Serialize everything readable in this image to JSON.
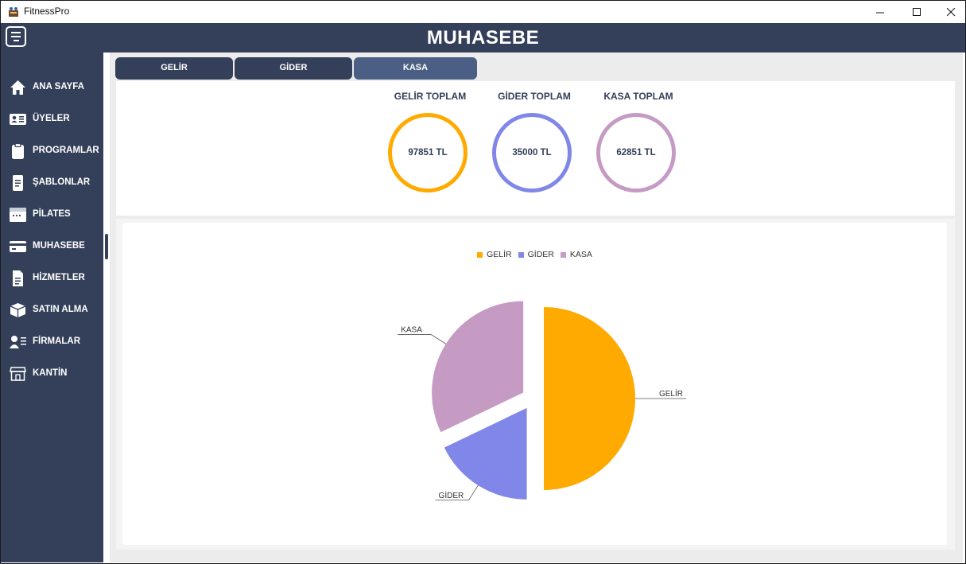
{
  "window": {
    "title": "FitnessPro",
    "controls": {
      "minimize": "—",
      "maximize": "☐",
      "close": "✕"
    }
  },
  "header": {
    "title": "MUHASEBE"
  },
  "sidebar": {
    "items": [
      {
        "label": "ANA SAYFA",
        "icon": "home-icon"
      },
      {
        "label": "ÜYELER",
        "icon": "member-card-icon"
      },
      {
        "label": "PROGRAMLAR",
        "icon": "clipboard-icon"
      },
      {
        "label": "ŞABLONLAR",
        "icon": "document-icon"
      },
      {
        "label": "PİLATES",
        "icon": "calendar-icon"
      },
      {
        "label": "MUHASEBE",
        "icon": "credit-card-icon",
        "active": true
      },
      {
        "label": "HİZMETLER",
        "icon": "file-icon"
      },
      {
        "label": "SATIN ALMA",
        "icon": "gift-box-icon"
      },
      {
        "label": "FİRMALAR",
        "icon": "person-list-icon"
      },
      {
        "label": "KANTİN",
        "icon": "store-icon"
      }
    ]
  },
  "tabs": [
    {
      "label": "GELİR",
      "active": false
    },
    {
      "label": "GİDER",
      "active": false
    },
    {
      "label": "KASA",
      "active": true
    }
  ],
  "totals": [
    {
      "title": "GELİR TOPLAM",
      "value": "97851 TL",
      "color": "#ffaa00"
    },
    {
      "title": "GİDER TOPLAM",
      "value": "35000 TL",
      "color": "#8087e8"
    },
    {
      "title": "KASA TOPLAM",
      "value": "62851 TL",
      "color": "#c59bc3"
    }
  ],
  "colors": {
    "navy": "#34405a",
    "tab_active": "#4b5f85",
    "background": "#ececec"
  },
  "chart_data": {
    "type": "pie",
    "title": "",
    "legend_position": "top-center",
    "categories": [
      "GELİR",
      "GİDER",
      "KASA"
    ],
    "values": [
      97851,
      35000,
      62851
    ],
    "colors": [
      "#ffaa00",
      "#8087e8",
      "#c59bc3"
    ],
    "exploded": true
  }
}
